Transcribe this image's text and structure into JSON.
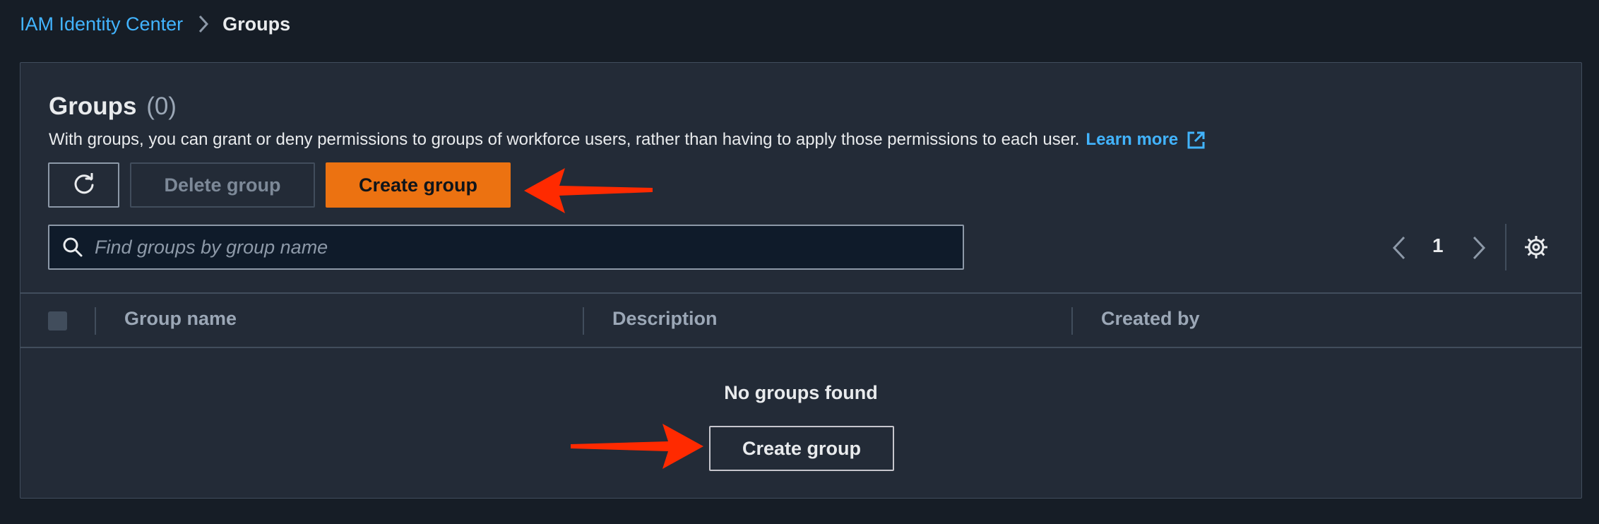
{
  "breadcrumb": {
    "parent": "IAM Identity Center",
    "current": "Groups"
  },
  "header": {
    "title": "Groups",
    "count": "(0)",
    "description": "With groups, you can grant or deny permissions to groups of workforce users, rather than having to apply those permissions to each user.",
    "learn_more": "Learn more"
  },
  "toolbar": {
    "refresh_icon": "refresh-icon",
    "delete_label": "Delete group",
    "create_label": "Create group"
  },
  "search": {
    "placeholder": "Find groups by group name",
    "value": ""
  },
  "pagination": {
    "current_page": "1"
  },
  "table": {
    "columns": [
      "Group name",
      "Description",
      "Created by"
    ],
    "rows": []
  },
  "empty_state": {
    "title": "No groups found",
    "create_label": "Create group"
  },
  "colors": {
    "accent": "#ec7211",
    "link": "#42b4ff",
    "annotation_arrow": "#ff2a00"
  }
}
